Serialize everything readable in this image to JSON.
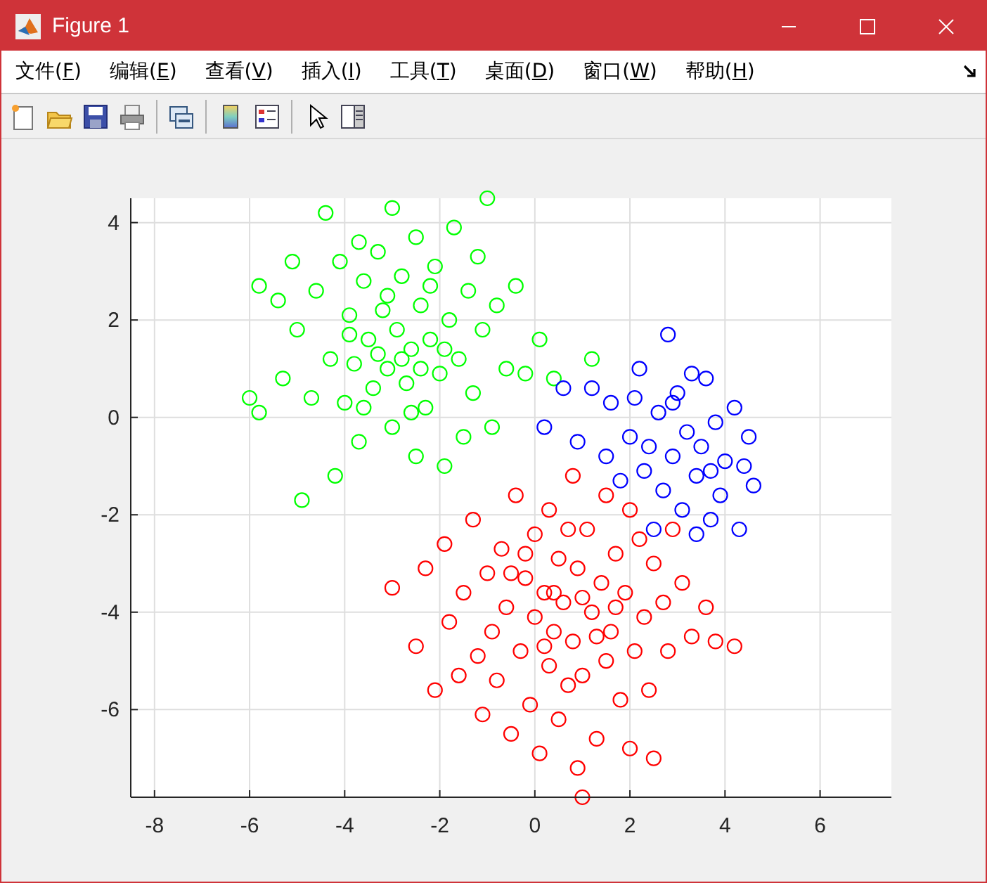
{
  "window": {
    "title": "Figure 1"
  },
  "menu": [
    {
      "label": "文件(F)"
    },
    {
      "label": "编辑(E)"
    },
    {
      "label": "查看(V)"
    },
    {
      "label": "插入(I)"
    },
    {
      "label": "工具(T)"
    },
    {
      "label": "桌面(D)"
    },
    {
      "label": "窗口(W)"
    },
    {
      "label": "帮助(H)"
    }
  ],
  "plot": {
    "chart_data": {
      "type": "scatter",
      "grid": true,
      "xlim": [
        -8.5,
        7.5
      ],
      "ylim": [
        -7.8,
        4.5
      ],
      "xticks": [
        -8,
        -6,
        -4,
        -2,
        0,
        2,
        4,
        6
      ],
      "yticks": [
        -6,
        -4,
        -2,
        0,
        2,
        4
      ],
      "series": [
        {
          "color": "#00ff00",
          "x": [
            -6,
            -5.8,
            -5.8,
            -5.4,
            -5.3,
            -5.1,
            -5,
            -4.9,
            -4.7,
            -4.6,
            -4.4,
            -4.3,
            -4.2,
            -4.1,
            -4,
            -3.9,
            -3.8,
            -3.7,
            -3.6,
            -3.5,
            -3.4,
            -3.3,
            -3.2,
            -3.1,
            -3,
            -3,
            -2.9,
            -2.8,
            -2.7,
            -2.6,
            -2.5,
            -2.5,
            -2.4,
            -2.3,
            -2.2,
            -2.1,
            -2,
            -1.9,
            -1.8,
            -1.7,
            -1.6,
            -1.5,
            -1.4,
            -1.3,
            -1.2,
            -1.1,
            -1,
            -0.9,
            -0.8,
            -0.6,
            -0.4,
            -0.2,
            0.1,
            -3.9,
            -3.3,
            -2.6,
            -2.2,
            -3.6,
            -1.9,
            -2.8,
            -3.1,
            -2.4,
            -3.7,
            0.4,
            1.2
          ],
          "values": [
            0.4,
            0.1,
            2.7,
            2.4,
            0.8,
            3.2,
            1.8,
            -1.7,
            0.4,
            2.6,
            4.2,
            1.2,
            -1.2,
            3.2,
            0.3,
            2.1,
            1.1,
            -0.5,
            2.8,
            1.6,
            0.6,
            3.4,
            2.2,
            1,
            -0.2,
            4.3,
            1.8,
            2.9,
            0.7,
            1.4,
            -0.8,
            3.7,
            2.3,
            0.2,
            1.6,
            3.1,
            0.9,
            -1,
            2,
            3.9,
            1.2,
            -0.4,
            2.6,
            0.5,
            3.3,
            1.8,
            4.5,
            -0.2,
            2.3,
            1,
            2.7,
            0.9,
            1.6,
            1.7,
            1.3,
            0.1,
            2.7,
            0.2,
            1.4,
            1.2,
            2.5,
            1,
            3.6,
            0.8,
            1.2
          ]
        },
        {
          "color": "#0000ff",
          "x": [
            0.2,
            0.6,
            0.9,
            1.2,
            1.5,
            1.6,
            1.8,
            2,
            2.1,
            2.3,
            2.4,
            2.6,
            2.7,
            2.8,
            2.9,
            3,
            3.1,
            3.2,
            3.3,
            3.4,
            3.5,
            3.6,
            3.7,
            3.8,
            3.9,
            4,
            4.2,
            4.3,
            4.4,
            4.5,
            4.6,
            2.5,
            3.4,
            2.2,
            3.7,
            2.9
          ],
          "values": [
            -0.2,
            0.6,
            -0.5,
            0.6,
            -0.8,
            0.3,
            -1.3,
            -0.4,
            0.4,
            -1.1,
            -0.6,
            0.1,
            -1.5,
            1.7,
            -0.8,
            0.5,
            -1.9,
            -0.3,
            0.9,
            -1.2,
            -0.6,
            0.8,
            -2.1,
            -0.1,
            -1.6,
            -0.9,
            0.2,
            -2.3,
            -1,
            -0.4,
            -1.4,
            -2.3,
            -2.4,
            1,
            -1.1,
            0.3
          ]
        },
        {
          "color": "#ff0000",
          "x": [
            -3,
            -2.5,
            -2.3,
            -2.1,
            -1.9,
            -1.8,
            -1.6,
            -1.5,
            -1.3,
            -1.2,
            -1.1,
            -1,
            -0.9,
            -0.8,
            -0.7,
            -0.6,
            -0.5,
            -0.4,
            -0.3,
            -0.2,
            -0.1,
            0,
            0,
            0.1,
            0.2,
            0.3,
            0.3,
            0.4,
            0.5,
            0.5,
            0.6,
            0.7,
            0.8,
            0.8,
            0.9,
            0.9,
            1,
            1,
            1.1,
            1.2,
            1.3,
            1.4,
            1.5,
            1.5,
            1.6,
            1.7,
            1.8,
            1.9,
            2,
            2,
            2.1,
            2.2,
            2.3,
            2.4,
            2.5,
            2.5,
            2.7,
            2.8,
            2.9,
            3.1,
            3.3,
            3.6,
            3.8,
            4.2,
            -0.5,
            0.4,
            1,
            0.2,
            1.3,
            -0.2,
            0.7,
            1.7
          ],
          "values": [
            -3.5,
            -4.7,
            -3.1,
            -5.6,
            -2.6,
            -4.2,
            -5.3,
            -3.6,
            -2.1,
            -4.9,
            -6.1,
            -3.2,
            -4.4,
            -5.4,
            -2.7,
            -3.9,
            -6.5,
            -1.6,
            -4.8,
            -3.3,
            -5.9,
            -2.4,
            -4.1,
            -6.9,
            -3.6,
            -5.1,
            -1.9,
            -4.4,
            -2.9,
            -6.2,
            -3.8,
            -5.5,
            -1.2,
            -4.6,
            -3.1,
            -7.2,
            -7.8,
            -5.3,
            -2.3,
            -4,
            -6.6,
            -3.4,
            -1.6,
            -5,
            -4.4,
            -2.8,
            -5.8,
            -3.6,
            -6.8,
            -1.9,
            -4.8,
            -2.5,
            -4.1,
            -5.6,
            -3,
            -7,
            -3.8,
            -4.8,
            -2.3,
            -3.4,
            -4.5,
            -3.9,
            -4.6,
            -4.7,
            -3.2,
            -3.6,
            -3.7,
            -4.7,
            -4.5,
            -2.8,
            -2.3,
            -3.9
          ]
        }
      ]
    }
  }
}
